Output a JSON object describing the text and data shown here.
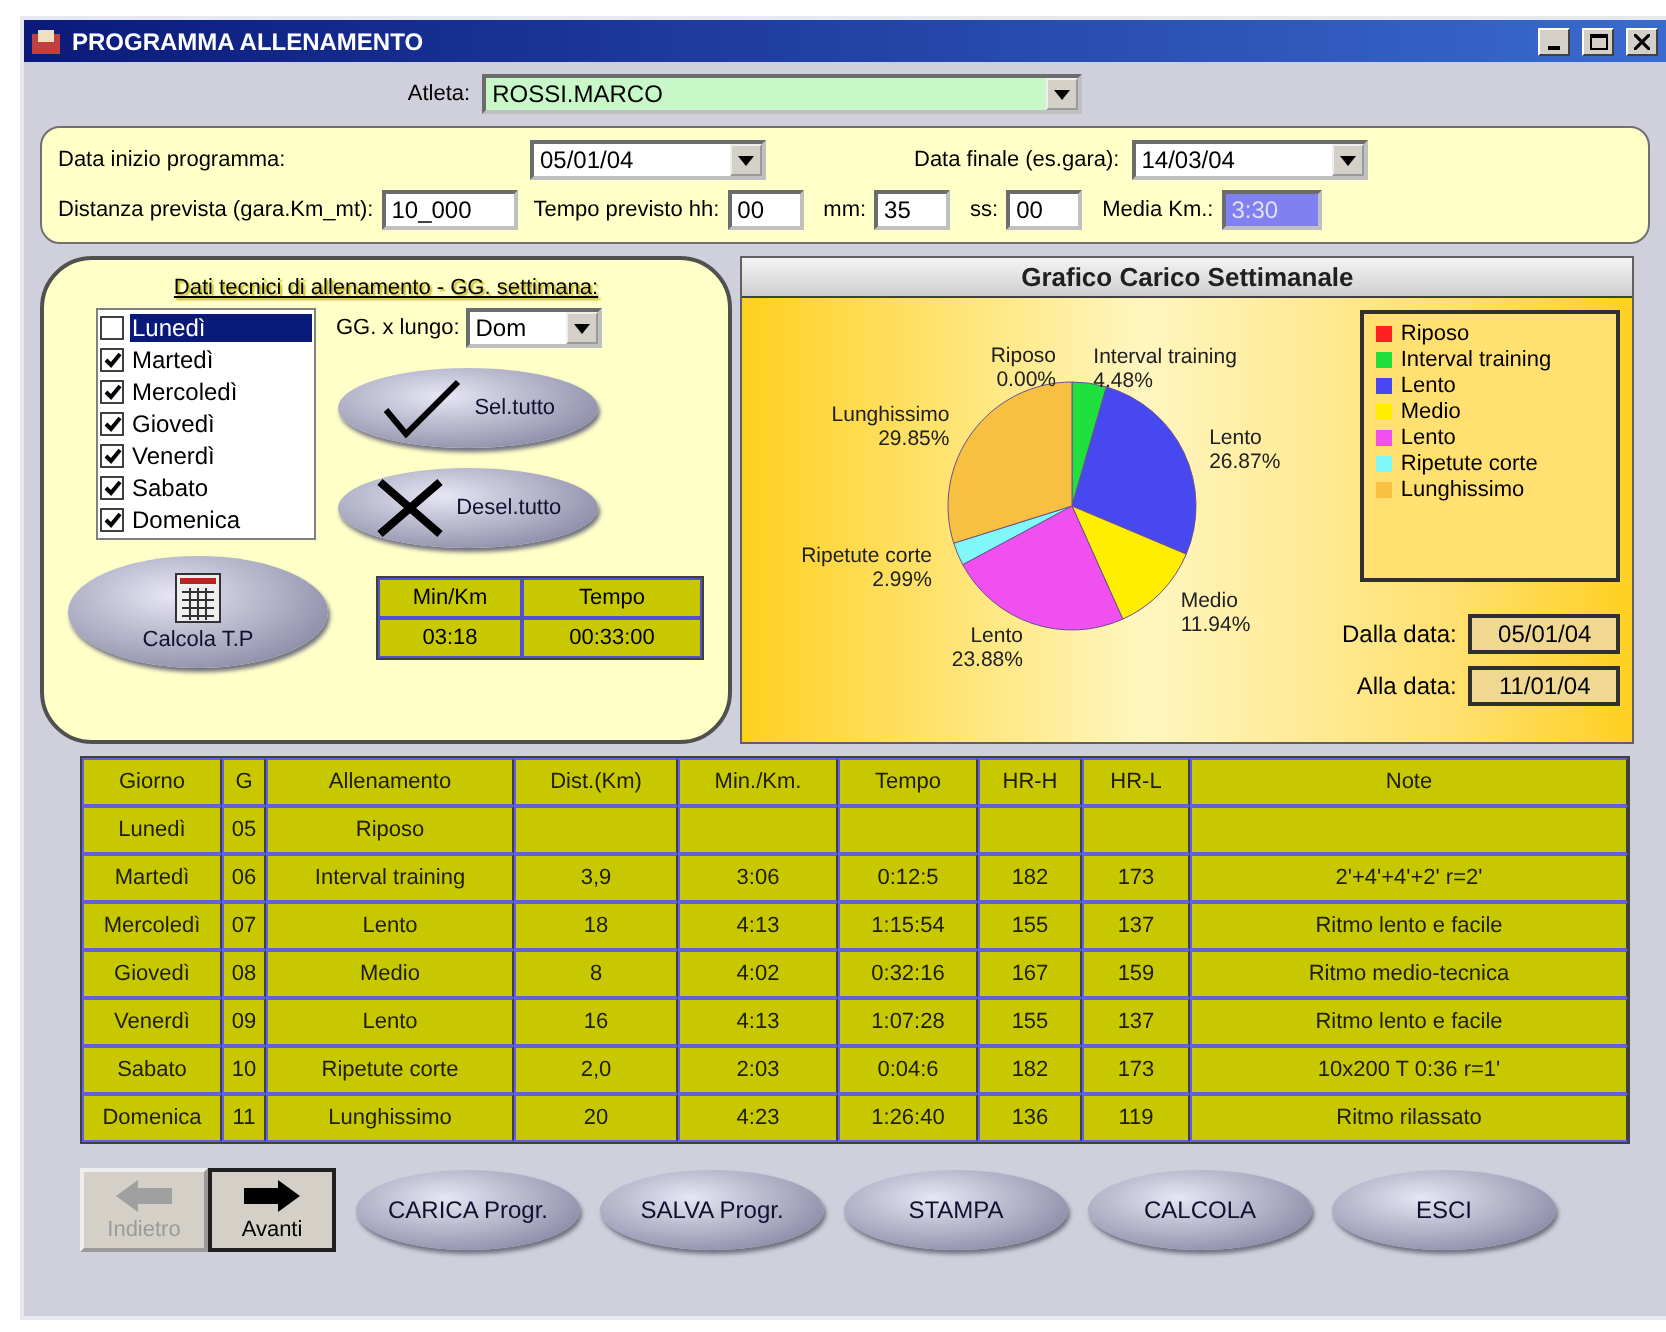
{
  "window": {
    "title": "PROGRAMMA ALLENAMENTO"
  },
  "athlete": {
    "label": "Atleta:",
    "value": "ROSSI.MARCO"
  },
  "program": {
    "start_label": "Data inizio programma:",
    "start_value": "05/01/04",
    "end_label": "Data finale (es.gara):",
    "end_value": "14/03/04",
    "distance_label": "Distanza prevista (gara.Km_mt):",
    "distance_value": "10_000",
    "time_label": "Tempo previsto hh:",
    "hh": "00",
    "mm_label": "mm:",
    "mm": "35",
    "ss_label": "ss:",
    "ss": "00",
    "average_label": "Media Km.:",
    "average_value": "3:30"
  },
  "training": {
    "title": "Dati tecnici di allenamento - GG. settimana:",
    "days": [
      {
        "label": "Lunedì",
        "checked": false,
        "selected": true
      },
      {
        "label": "Martedì",
        "checked": true,
        "selected": false
      },
      {
        "label": "Mercoledì",
        "checked": true,
        "selected": false
      },
      {
        "label": "Giovedì",
        "checked": true,
        "selected": false
      },
      {
        "label": "Venerdì",
        "checked": true,
        "selected": false
      },
      {
        "label": "Sabato",
        "checked": true,
        "selected": false
      },
      {
        "label": "Domenica",
        "checked": true,
        "selected": false
      }
    ],
    "long_day_label": "GG. x lungo:",
    "long_day_value": "Dom",
    "select_all": "Sel.tutto",
    "deselect_all": "Desel.tutto",
    "calc_button": "Calcola T.P",
    "result_columns": [
      "Min/Km",
      "Tempo"
    ],
    "result_values": [
      "03:18",
      "00:33:00"
    ]
  },
  "chart": {
    "title": "Grafico Carico Settimanale",
    "chart_data": {
      "type": "pie",
      "categories": [
        "Riposo",
        "Interval training",
        "Lento",
        "Medio",
        "Lento",
        "Ripetute corte",
        "Lunghissimo"
      ],
      "series": [
        {
          "values": [
            0,
            4.48,
            26.87,
            11.94,
            23.88,
            2.99,
            29.85
          ]
        }
      ],
      "value_labels": [
        "0.00%",
        "4.48%",
        "26.87%",
        "11.94%",
        "23.88%",
        "2.99%",
        "29.85%"
      ]
    },
    "legend": [
      {
        "label": "Riposo",
        "color": "#ff2020"
      },
      {
        "label": "Interval training",
        "color": "#20e040"
      },
      {
        "label": "Lento",
        "color": "#4848f0"
      },
      {
        "label": "Medio",
        "color": "#ffee00"
      },
      {
        "label": "Lento",
        "color": "#f050f0"
      },
      {
        "label": "Ripetute corte",
        "color": "#80f8f8"
      },
      {
        "label": "Lunghissimo",
        "color": "#f8c040"
      }
    ],
    "from_label": "Dalla data:",
    "from_value": "05/01/04",
    "to_label": "Alla data:",
    "to_value": "11/01/04"
  },
  "table": {
    "columns": [
      "Giorno",
      "G",
      "Allenamento",
      "Dist.(Km)",
      "Min./Km.",
      "Tempo",
      "HR-H",
      "HR-L",
      "Note"
    ],
    "rows": [
      [
        "Lunedì",
        "05",
        "Riposo",
        "",
        "",
        "",
        "",
        "",
        ""
      ],
      [
        "Martedì",
        "06",
        "Interval training",
        "3,9",
        "3:06",
        "0:12:5",
        "182",
        "173",
        "2'+4'+4'+2' r=2'"
      ],
      [
        "Mercoledì",
        "07",
        "Lento",
        "18",
        "4:13",
        "1:15:54",
        "155",
        "137",
        "Ritmo lento e facile"
      ],
      [
        "Giovedì",
        "08",
        "Medio",
        "8",
        "4:02",
        "0:32:16",
        "167",
        "159",
        "Ritmo medio-tecnica"
      ],
      [
        "Venerdì",
        "09",
        "Lento",
        "16",
        "4:13",
        "1:07:28",
        "155",
        "137",
        "Ritmo lento e facile"
      ],
      [
        "Sabato",
        "10",
        "Ripetute corte",
        "2,0",
        "2:03",
        "0:04:6",
        "182",
        "173",
        "10x200 T 0:36 r=1'"
      ],
      [
        "Domenica",
        "11",
        "Lunghissimo",
        "20",
        "4:23",
        "1:26:40",
        "136",
        "119",
        "Ritmo rilassato"
      ]
    ]
  },
  "nav": [
    {
      "label": "Indietro",
      "kind": "back",
      "disabled": true
    },
    {
      "label": "Avanti",
      "kind": "forward",
      "disabled": false
    }
  ],
  "buttons": [
    "CARICA Progr.",
    "SALVA Progr.",
    "STAMPA",
    "CALCOLA",
    "ESCI"
  ]
}
